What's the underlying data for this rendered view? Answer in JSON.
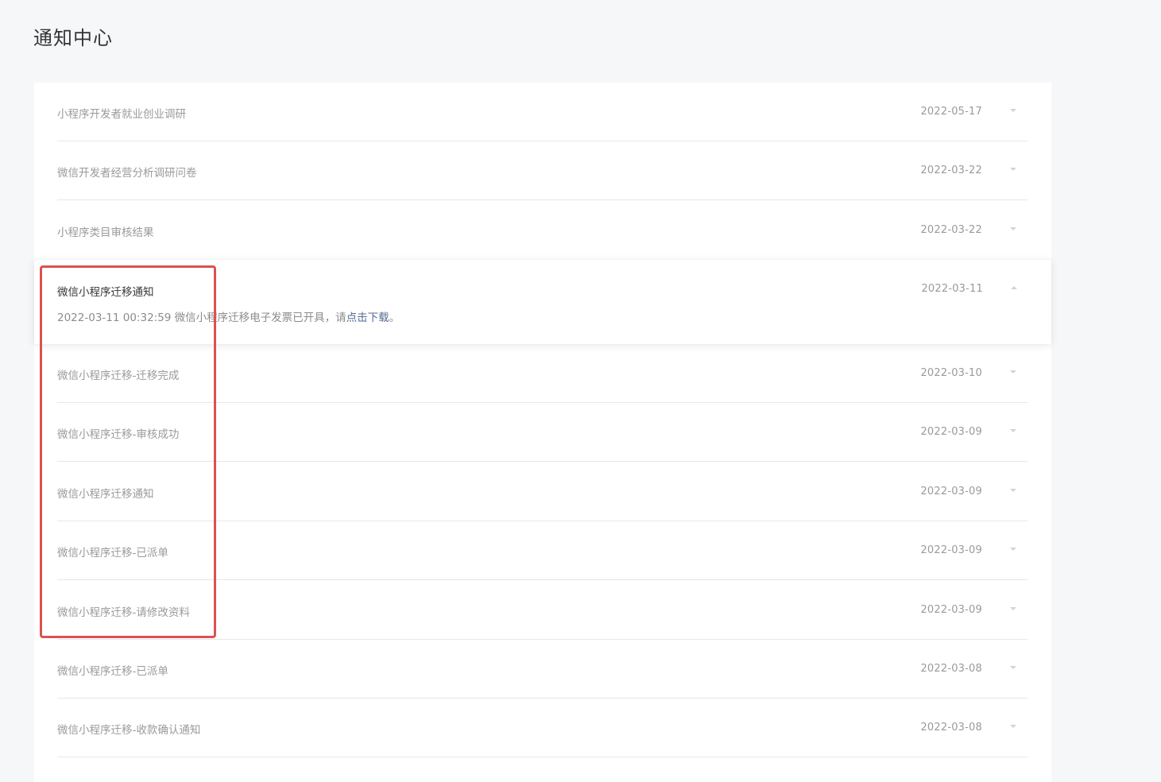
{
  "page": {
    "title": "通知中心"
  },
  "notifications": [
    {
      "title": "小程序开发者就业创业调研",
      "date": "2022-05-17"
    },
    {
      "title": "微信开发者经营分析调研问卷",
      "date": "2022-03-22"
    },
    {
      "title": "小程序类目审核结果",
      "date": "2022-03-22"
    },
    {
      "title": "微信小程序迁移通知",
      "date": "2022-03-11"
    },
    {
      "title": "微信小程序迁移-迁移完成",
      "date": "2022-03-10"
    },
    {
      "title": "微信小程序迁移-审核成功",
      "date": "2022-03-09"
    },
    {
      "title": "微信小程序迁移通知",
      "date": "2022-03-09"
    },
    {
      "title": "微信小程序迁移-已派单",
      "date": "2022-03-09"
    },
    {
      "title": "微信小程序迁移-请修改资料",
      "date": "2022-03-09"
    },
    {
      "title": "微信小程序迁移-已派单",
      "date": "2022-03-08"
    },
    {
      "title": "微信小程序迁移-收款确认通知",
      "date": "2022-03-08"
    }
  ],
  "expanded_detail": {
    "text_prefix": "2022-03-11 00:32:59 微信小程序迁移电子发票已开具，请",
    "link_text": "点击下载",
    "text_suffix": "。"
  },
  "icons": {
    "collapsed": "caret-down-icon",
    "expanded": "caret-up-icon"
  },
  "colors": {
    "link": "#576b95",
    "highlight_box": "#d9534f",
    "background": "#f6f7f9"
  }
}
